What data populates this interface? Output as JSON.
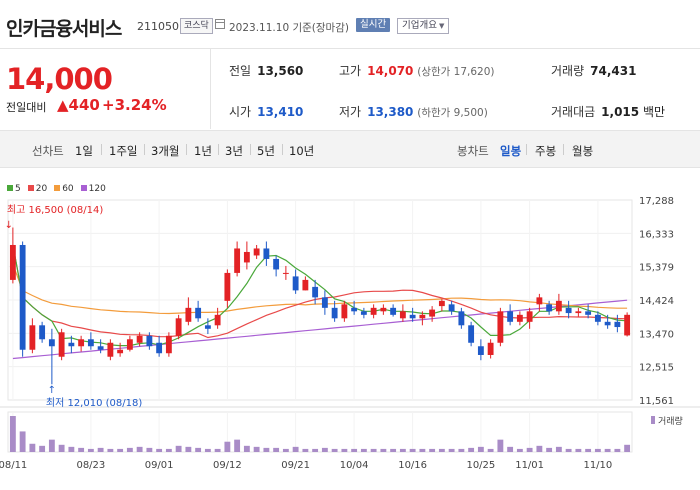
{
  "header": {
    "stock_name": "인카금융서비스",
    "stock_code": "211050",
    "market_badge": "코스닥",
    "date_text": "2023.11.10 기준(장마감)",
    "realtime_label": "실시간",
    "company_info_label": "기업개요"
  },
  "price": {
    "current": "14,000",
    "change_label": "전일대비",
    "change_value": "▲440",
    "change_pct": "+3.24%"
  },
  "stats": {
    "prev_close_label": "전일",
    "prev_close": "13,560",
    "high_label": "고가",
    "high": "14,070",
    "upper_limit": "(상한가 17,620)",
    "volume_label": "거래량",
    "volume": "74,431",
    "open_label": "시가",
    "open": "13,410",
    "low_label": "저가",
    "low": "13,380",
    "lower_limit": "(하한가 9,500)",
    "amount_label": "거래대금",
    "amount": "1,015",
    "amount_unit": "백만"
  },
  "periods": {
    "line_label": "선차트",
    "line_items": [
      "1일",
      "1주일",
      "3개월",
      "1년",
      "3년",
      "5년",
      "10년"
    ],
    "candle_label": "봉차트",
    "candle_items": [
      "일봉",
      "주봉",
      "월봉"
    ],
    "candle_active": "일봉"
  },
  "colors": {
    "up": "#e32225",
    "down": "#1e5ac8",
    "ma5": "#4aa83a",
    "ma20": "#e84a4a",
    "ma60": "#f39c3c",
    "ma120": "#a85fd3"
  },
  "chart_data": {
    "type": "candlestick",
    "legend": [
      {
        "name": "5",
        "color": "#4aa83a"
      },
      {
        "name": "20",
        "color": "#e84a4a"
      },
      {
        "name": "60",
        "color": "#f39c3c"
      },
      {
        "name": "120",
        "color": "#a85fd3"
      }
    ],
    "y_ticks": [
      "17,288",
      "16,333",
      "15,379",
      "14,424",
      "13,470",
      "12,515",
      "11,561"
    ],
    "ylim": [
      11561,
      17288
    ],
    "x_ticks": [
      {
        "label": "08/11",
        "index": 0
      },
      {
        "label": "08/23",
        "index": 8
      },
      {
        "label": "09/01",
        "index": 15
      },
      {
        "label": "09/12",
        "index": 22
      },
      {
        "label": "09/21",
        "index": 29
      },
      {
        "label": "10/04",
        "index": 35
      },
      {
        "label": "10/16",
        "index": 41
      },
      {
        "label": "10/25",
        "index": 48
      },
      {
        "label": "11/01",
        "index": 53
      },
      {
        "label": "11/10",
        "index": 60
      }
    ],
    "annotation_high": "최고 16,500 (08/14)",
    "annotation_low": "최저 12,010 (08/18)",
    "volume_legend": "거래량",
    "candles": [
      [
        15000,
        16500,
        14900,
        16000
      ],
      [
        16000,
        16100,
        12800,
        13000
      ],
      [
        13000,
        13900,
        12900,
        13700
      ],
      [
        13700,
        13800,
        13200,
        13300
      ],
      [
        13300,
        13600,
        12010,
        13100
      ],
      [
        12800,
        13600,
        12700,
        13500
      ],
      [
        13200,
        13400,
        12900,
        13100
      ],
      [
        13100,
        13400,
        12950,
        13300
      ],
      [
        13300,
        13500,
        13000,
        13100
      ],
      [
        13100,
        13300,
        12900,
        13000
      ],
      [
        12800,
        13300,
        12700,
        13200
      ],
      [
        12900,
        13200,
        12800,
        13000
      ],
      [
        13000,
        13400,
        12950,
        13300
      ],
      [
        13200,
        13500,
        13100,
        13400
      ],
      [
        13400,
        13500,
        13000,
        13100
      ],
      [
        13200,
        13400,
        12800,
        12900
      ],
      [
        12900,
        13500,
        12800,
        13400
      ],
      [
        13400,
        14000,
        13300,
        13900
      ],
      [
        13800,
        14500,
        13700,
        14200
      ],
      [
        14200,
        14400,
        13800,
        13900
      ],
      [
        13700,
        13900,
        13450,
        13600
      ],
      [
        13700,
        14200,
        13600,
        14000
      ],
      [
        14400,
        15300,
        14200,
        15200
      ],
      [
        15200,
        16100,
        15100,
        15900
      ],
      [
        15500,
        16100,
        15300,
        15800
      ],
      [
        15700,
        16000,
        15600,
        15900
      ],
      [
        15900,
        16100,
        15400,
        15600
      ],
      [
        15600,
        15700,
        15100,
        15300
      ],
      [
        15200,
        15400,
        15000,
        15200
      ],
      [
        15100,
        15300,
        14600,
        14700
      ],
      [
        14700,
        15100,
        14700,
        15000
      ],
      [
        14800,
        15000,
        14300,
        14500
      ],
      [
        14500,
        14700,
        14000,
        14200
      ],
      [
        14200,
        14400,
        13800,
        13900
      ],
      [
        13900,
        14400,
        13800,
        14300
      ],
      [
        14200,
        14400,
        14000,
        14100
      ],
      [
        14100,
        14200,
        13900,
        14000
      ],
      [
        14000,
        14300,
        13900,
        14200
      ],
      [
        14100,
        14300,
        14000,
        14200
      ],
      [
        14200,
        14300,
        13950,
        14000
      ],
      [
        13900,
        14300,
        13800,
        14100
      ],
      [
        14000,
        14200,
        13800,
        13900
      ],
      [
        13900,
        14100,
        13700,
        14000
      ],
      [
        13950,
        14250,
        13800,
        14150
      ],
      [
        14250,
        14450,
        14100,
        14400
      ],
      [
        14300,
        14400,
        14000,
        14100
      ],
      [
        14100,
        14200,
        13600,
        13700
      ],
      [
        13700,
        13800,
        13100,
        13200
      ],
      [
        13100,
        13300,
        12700,
        12850
      ],
      [
        12850,
        13300,
        12750,
        13200
      ],
      [
        13200,
        14200,
        13100,
        14100
      ],
      [
        14100,
        14300,
        13700,
        13800
      ],
      [
        13800,
        14100,
        13700,
        14000
      ],
      [
        13800,
        14200,
        13600,
        14100
      ],
      [
        14300,
        14600,
        14100,
        14500
      ],
      [
        14300,
        14400,
        14000,
        14100
      ],
      [
        14100,
        14600,
        14000,
        14400
      ],
      [
        14200,
        14400,
        13900,
        14050
      ],
      [
        14050,
        14200,
        13950,
        14100
      ],
      [
        14100,
        14300,
        13900,
        14000
      ],
      [
        14000,
        14100,
        13700,
        13800
      ],
      [
        13800,
        14000,
        13600,
        13700
      ],
      [
        13800,
        14000,
        13500,
        13650
      ],
      [
        13410,
        14070,
        13380,
        14000
      ]
    ],
    "volumes": [
      35,
      20,
      8,
      6,
      12,
      7,
      5,
      4,
      3,
      4,
      3,
      3,
      4,
      5,
      4,
      3,
      3,
      6,
      5,
      4,
      3,
      3,
      10,
      12,
      6,
      5,
      4,
      4,
      3,
      5,
      3,
      3,
      4,
      3,
      3,
      3,
      3,
      3,
      3,
      3,
      3,
      3,
      3,
      3,
      3,
      3,
      3,
      4,
      5,
      3,
      12,
      5,
      3,
      4,
      6,
      4,
      5,
      3,
      3,
      3,
      3,
      3,
      3,
      7
    ]
  }
}
